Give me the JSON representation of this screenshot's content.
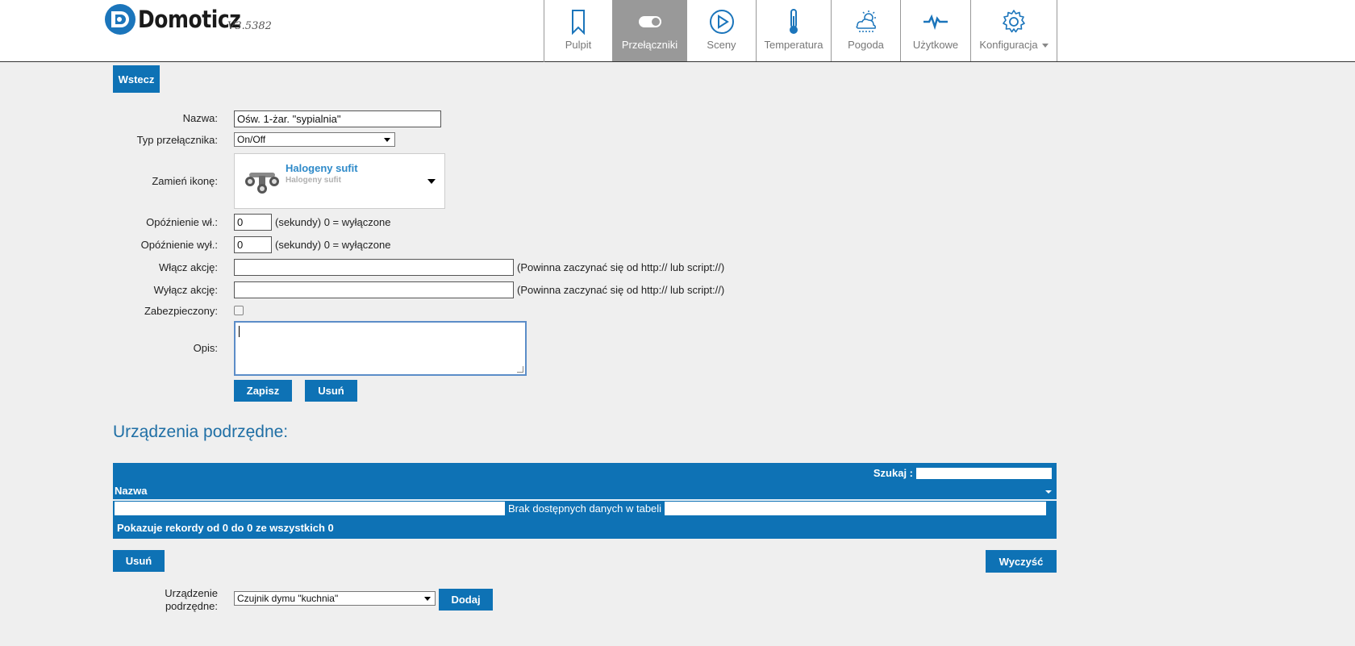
{
  "app": {
    "name": "Domoticz",
    "version": "V3.5382"
  },
  "nav": [
    {
      "label": "Pulpit",
      "icon": "bookmark-icon",
      "active": false
    },
    {
      "label": "Przełączniki",
      "icon": "toggle-icon",
      "active": true
    },
    {
      "label": "Sceny",
      "icon": "play-icon",
      "active": false
    },
    {
      "label": "Temperatura",
      "icon": "thermometer-icon",
      "active": false
    },
    {
      "label": "Pogoda",
      "icon": "weather-icon",
      "active": false
    },
    {
      "label": "Użytkowe",
      "icon": "pulse-icon",
      "active": false
    },
    {
      "label": "Konfiguracja",
      "icon": "gear-icon",
      "active": false
    }
  ],
  "back_button": "Wstecz",
  "form": {
    "name_label": "Nazwa:",
    "name_value": "Ośw. 1-żar. \"sypialnia\"",
    "switch_type_label": "Typ przełącznika:",
    "switch_type_value": "On/Off",
    "icon_label": "Zamień ikonę:",
    "icon_title": "Halogeny sufit",
    "icon_subtitle": "Halogeny sufit",
    "on_delay_label": "Opóźnienie wł.:",
    "on_delay_value": "0",
    "off_delay_label": "Opóźnienie wył.:",
    "off_delay_value": "0",
    "delay_hint": "(sekundy) 0 = wyłączone",
    "on_action_label": "Włącz akcję:",
    "off_action_label": "Wyłącz akcję:",
    "action_hint": "(Powinna zaczynać się od http:// lub script://)",
    "protected_label": "Zabezpieczony:",
    "description_label": "Opis:",
    "save_button": "Zapisz",
    "delete_button": "Usuń"
  },
  "subdevices": {
    "title": "Urządzenia podrzędne:",
    "search_label": "Szukaj :",
    "column_name": "Nazwa",
    "empty_message": "Brak dostępnych danych w tabeli",
    "info": "Pokazuje rekordy od 0 do 0 ze wszystkich 0",
    "delete_button": "Usuń",
    "clear_button": "Wyczyść",
    "device_label_line1": "Urządzenie",
    "device_label_line2": "podrzędne:",
    "device_value": "Czujnik dymu \"kuchnia\"",
    "add_button": "Dodaj"
  },
  "colors": {
    "accent": "#0e72b5",
    "active_tab": "#999999",
    "title": "#1f6fa5"
  }
}
